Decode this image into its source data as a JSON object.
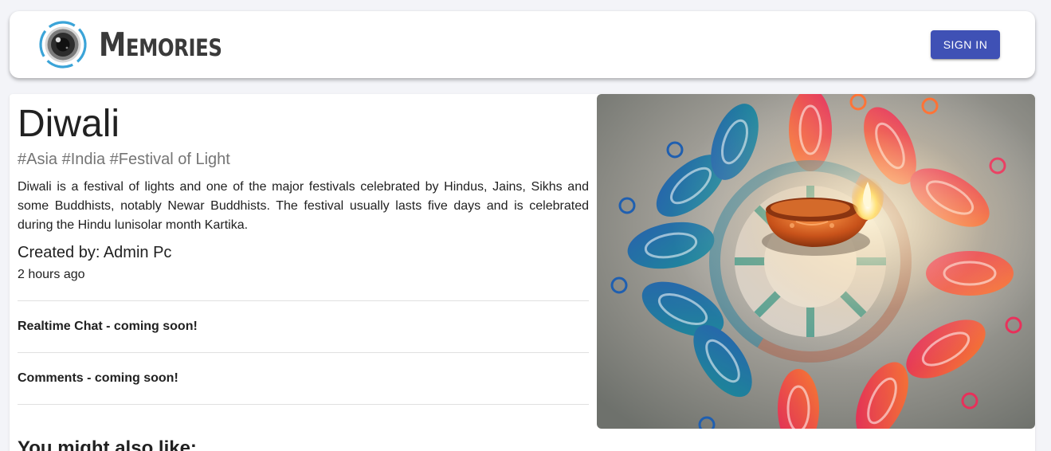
{
  "header": {
    "brand": "Memories",
    "logo_icon": "camera-lens-icon",
    "signin_label": "SIGN IN",
    "accent_color": "#3f51b5",
    "logo_ring_color": "#3ba4d8"
  },
  "post": {
    "title": "Diwali",
    "tags": "#Asia #India #Festival of Light",
    "message": "Diwali is a festival of lights and one of the major festivals celebrated by Hindus, Jains, Sikhs and some Buddhists, notably Newar Buddhists. The festival usually lasts five days and is celebrated during the Hindu lunisolar month Kartika.",
    "creator": "Created by: Admin Pc",
    "time": "2 hours ago",
    "realtime_chat": "Realtime Chat - coming soon!",
    "comments": "Comments - coming soon!",
    "image_icon": "rangoli-diya-photo"
  },
  "recommended": {
    "heading": "You might also like:"
  }
}
